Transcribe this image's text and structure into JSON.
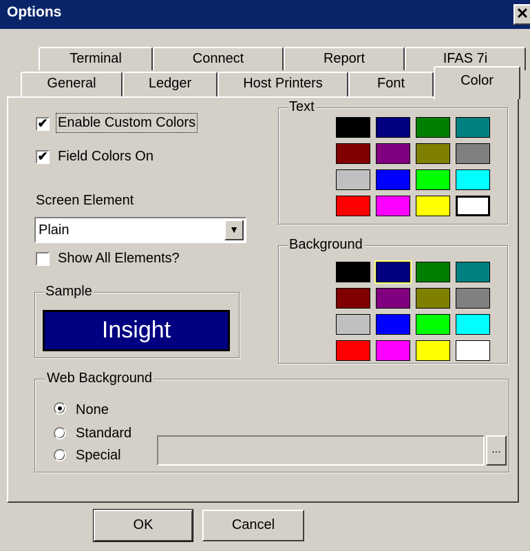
{
  "window": {
    "title": "Options",
    "close_glyph": "✕"
  },
  "tabs_back": [
    "Terminal",
    "Connect",
    "Report",
    "IFAS 7i"
  ],
  "tabs_front": [
    "General",
    "Ledger",
    "Host Printers",
    "Font",
    "Color"
  ],
  "color_tab": {
    "enable_custom_colors": {
      "label": "Enable Custom Colors",
      "checked": true
    },
    "field_colors_on": {
      "label": "Field Colors On",
      "checked": true
    },
    "screen_element": {
      "label": "Screen Element",
      "value": "Plain",
      "dropdown_glyph": "▼"
    },
    "show_all_elements": {
      "label": "Show All Elements?",
      "checked": false
    },
    "sample": {
      "label": "Sample",
      "text": "Insight",
      "bg_color": "#000080",
      "fg_color": "#ffffff"
    },
    "text_palette": {
      "label": "Text",
      "colors": [
        "#000000",
        "#000080",
        "#008000",
        "#008080",
        "#800000",
        "#800080",
        "#808000",
        "#808080",
        "#c0c0c0",
        "#0000ff",
        "#00ff00",
        "#00ffff",
        "#ff0000",
        "#ff00ff",
        "#ffff00",
        "#ffffff"
      ],
      "selected_color": "#ffffff"
    },
    "background_palette": {
      "label": "Background",
      "colors": [
        "#000000",
        "#000080",
        "#008000",
        "#008080",
        "#800000",
        "#800080",
        "#808000",
        "#808080",
        "#c0c0c0",
        "#0000ff",
        "#00ff00",
        "#00ffff",
        "#ff0000",
        "#ff00ff",
        "#ffff00",
        "#ffffff"
      ],
      "selected_color": "#000080"
    },
    "web_background": {
      "label": "Web Background",
      "options": [
        "None",
        "Standard",
        "Special"
      ],
      "selected": "None",
      "path_value": "",
      "browse_label": "..."
    }
  },
  "buttons": {
    "ok": "OK",
    "cancel": "Cancel"
  }
}
